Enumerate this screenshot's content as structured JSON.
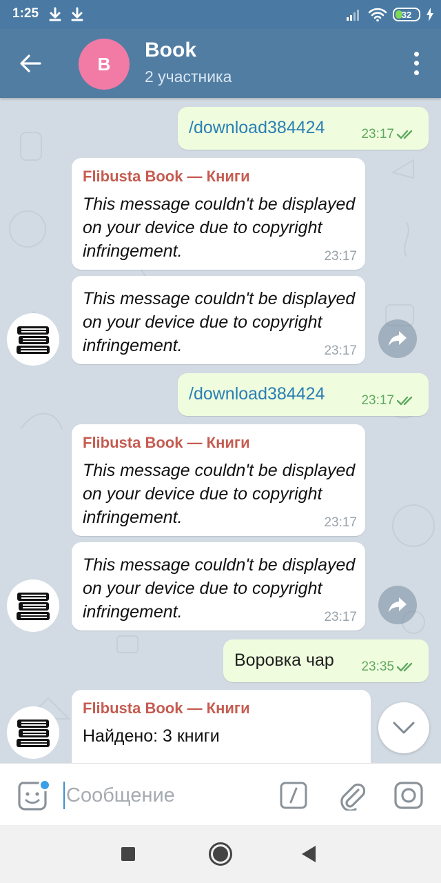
{
  "status_bar": {
    "time": "1:25",
    "battery": "32"
  },
  "header": {
    "title": "Book",
    "subtitle": "2 участника",
    "avatar_letter": "B",
    "avatar_color": "#f27ba5",
    "bg_color": "#527da3"
  },
  "messages": [
    {
      "dir": "out",
      "text": "/download384424",
      "time": "23:17",
      "status": "read"
    },
    {
      "dir": "in",
      "sender": "Flibusta Book — Книги",
      "text": "This message couldn't be displayed on your device due to copyright infringement.",
      "time": "23:17"
    },
    {
      "dir": "in",
      "text": "This message couldn't be displayed on your device due to copyright infringement.",
      "time": "23:17"
    },
    {
      "dir": "out",
      "text": "/download384424",
      "time": "23:17",
      "status": "read"
    },
    {
      "dir": "in",
      "sender": "Flibusta Book — Книги",
      "text": "This message couldn't be displayed on your device due to copyright infringement.",
      "time": "23:17"
    },
    {
      "dir": "in",
      "text": "This message couldn't be displayed on your device due to copyright infringement.",
      "time": "23:17"
    },
    {
      "dir": "out",
      "text": "Воровка чар",
      "time": "23:35",
      "status": "read"
    },
    {
      "dir": "in",
      "sender": "Flibusta Book — Книги",
      "text": "Найдено: 3 книги"
    }
  ],
  "input": {
    "placeholder": "Сообщение"
  },
  "icons": {
    "back": "arrow-left-icon",
    "menu": "more-vertical-icon",
    "share": "share-icon",
    "scroll": "chevron-down-icon",
    "emoji": "sticker-icon",
    "command": "slash-command-icon",
    "attach": "paperclip-icon",
    "camera": "camera-icon",
    "bot_avatar": "books-stack-icon"
  },
  "colors": {
    "outgoing_bubble": "#effdde",
    "incoming_bubble": "#ffffff",
    "sender_name": "#c55c51",
    "link_text": "#2b7fb4",
    "read_check": "#5ea860"
  }
}
